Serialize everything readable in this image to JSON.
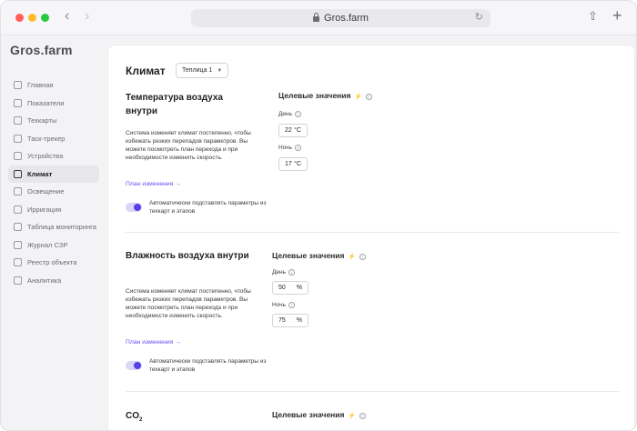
{
  "browser": {
    "url": "Gros.farm"
  },
  "sidebar": {
    "logo": "Gros.farm",
    "items": [
      {
        "label": "Главная",
        "icon": "home-icon"
      },
      {
        "label": "Показатели",
        "icon": "chart-icon"
      },
      {
        "label": "Техкарты",
        "icon": "doc-icon"
      },
      {
        "label": "Таск-трекер",
        "icon": "task-icon"
      },
      {
        "label": "Устройства",
        "icon": "device-icon"
      },
      {
        "label": "Климат",
        "icon": "climate-icon",
        "active": true
      },
      {
        "label": "Освещение",
        "icon": "sun-icon"
      },
      {
        "label": "Ирригация",
        "icon": "drop-icon"
      },
      {
        "label": "Таблица мониторинга",
        "icon": "table-icon"
      },
      {
        "label": "Журнал СЗР",
        "icon": "journal-icon"
      },
      {
        "label": "Реестр объекта",
        "icon": "registry-icon"
      },
      {
        "label": "Аналитика",
        "icon": "analytics-icon"
      }
    ]
  },
  "main": {
    "title": "Климат",
    "greenhouse_select": "Теплица 1",
    "sections": [
      {
        "title": "Температура воздуха внутри",
        "desc": "Система изменяет климат постепенно, чтобы избежать резких перепадов параметров. Вы можете посмотреть план перехода и при необходимости изменить скорость.",
        "plan_link": "План изменения  →",
        "auto_text": "Автоматически подставлять параметры из техкарт и этапов",
        "targets_title": "Целевые значения",
        "day_label": "День",
        "day_value": "22",
        "day_unit": "°C",
        "night_label": "Ночь",
        "night_value": "17",
        "night_unit": "°C"
      },
      {
        "title": "Влажность воздуха внутри",
        "desc": "Система изменяет климат постепенно, чтобы избежать резких перепадов параметров. Вы можете посмотреть план перехода и при необходимости изменить скорость.",
        "plan_link": "План изменения  →",
        "auto_text": "Автоматически подставлять параметры из техкарт и этапов",
        "targets_title": "Целевые значения",
        "day_label": "День",
        "day_value": "50",
        "day_unit": "%",
        "night_label": "Ночь",
        "night_value": "75",
        "night_unit": "%"
      },
      {
        "title": "CO",
        "title_sub": "2",
        "targets_title": "Целевые значения"
      }
    ]
  },
  "colors": {
    "accent": "#5a3fe6",
    "link": "#6a4cf0"
  }
}
